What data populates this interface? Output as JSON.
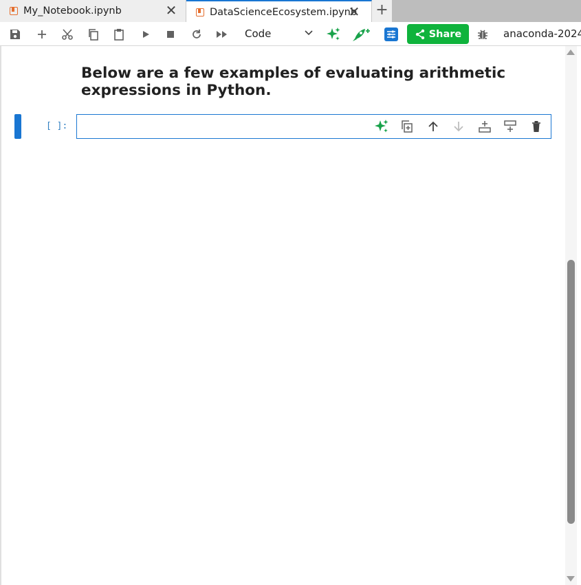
{
  "tabs": [
    {
      "title": "My_Notebook.ipynb",
      "active": false
    },
    {
      "title": "DataScienceEcosystem.ipynb",
      "active": true
    }
  ],
  "toolbar": {
    "cell_type": "Code",
    "share_label": "Share",
    "kernel": "anaconda-2024"
  },
  "markdown": {
    "text": "Below are a few examples of evaluating arithmetic expressions in Python."
  },
  "code_cell": {
    "prompt": "[ ]:"
  },
  "colors": {
    "accent": "#1976d2",
    "share": "#0fb33c",
    "assistant": "#18a24a"
  },
  "icons": {
    "toolbar": [
      "save-icon",
      "add-icon",
      "cut-icon",
      "copy-icon",
      "paste-icon",
      "run-icon",
      "stop-icon",
      "restart-icon",
      "run-all-icon",
      "assistant-sparkle-icon",
      "deploy-rocket-icon",
      "settings-icon",
      "share-icon",
      "debugger-icon"
    ],
    "cell": [
      "assistant-sparkle-icon",
      "duplicate-icon",
      "move-up-icon",
      "move-down-icon",
      "insert-above-icon",
      "insert-below-icon",
      "delete-icon"
    ]
  }
}
